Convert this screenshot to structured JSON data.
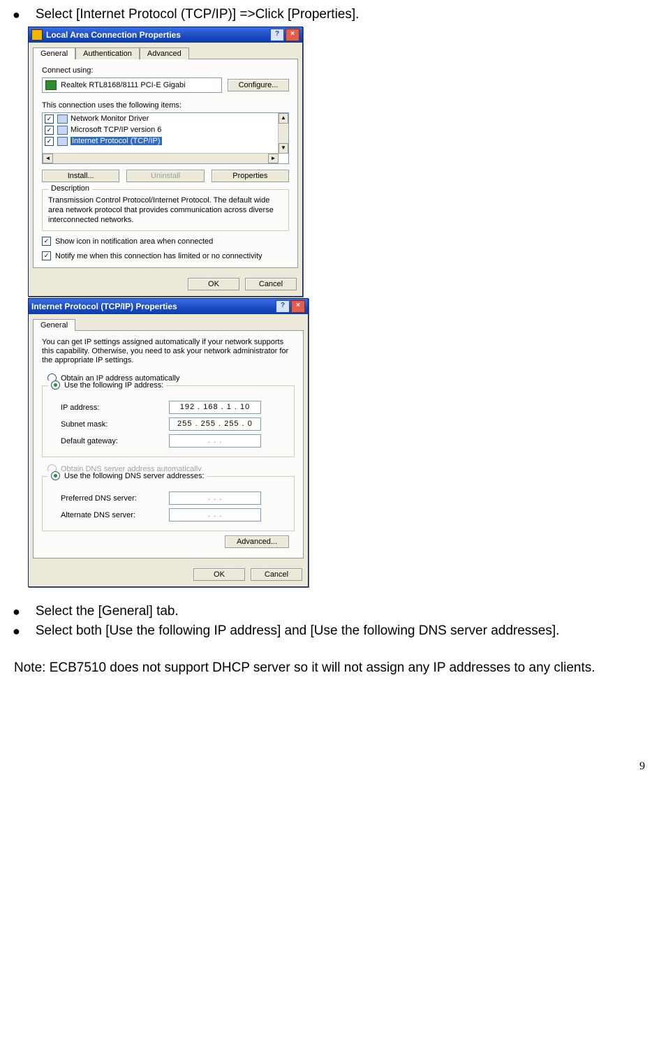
{
  "doc": {
    "bullet1": "Select [Internet Protocol (TCP/IP)] =>Click [Properties].",
    "bullet2": "Select the [General] tab.",
    "bullet3": "Select both [Use the following IP address] and [Use the following DNS server addresses].",
    "note": "Note: ECB7510 does not support DHCP server so it will not assign any IP addresses to any clients.",
    "page": "9"
  },
  "win1": {
    "title": "Local Area Connection Properties",
    "tabs": {
      "general": "General",
      "auth": "Authentication",
      "adv": "Advanced"
    },
    "connect_using_label": "Connect using:",
    "adapter": "Realtek RTL8168/8111 PCI-E Gigabi",
    "configure": "Configure...",
    "items_label": "This connection uses the following items:",
    "items": [
      "Network Monitor Driver",
      "Microsoft TCP/IP version 6",
      "Internet Protocol (TCP/IP)"
    ],
    "install": "Install...",
    "uninstall": "Uninstall",
    "properties": "Properties",
    "desc_legend": "Description",
    "desc_text": "Transmission Control Protocol/Internet Protocol. The default wide area network protocol that provides communication across diverse interconnected networks.",
    "show_icon": "Show icon in notification area when connected",
    "notify": "Notify me when this connection has limited or no connectivity",
    "ok": "OK",
    "cancel": "Cancel"
  },
  "win2": {
    "title": "Internet Protocol (TCP/IP) Properties",
    "tab_general": "General",
    "intro": "You can get IP settings assigned automatically if your network supports this capability. Otherwise, you need to ask your network administrator for the appropriate IP settings.",
    "obtain_ip": "Obtain an IP address automatically",
    "use_ip": "Use the following IP address:",
    "ip_label": "IP address:",
    "ip_value": "192 . 168 .  1  .  10",
    "subnet_label": "Subnet mask:",
    "subnet_value": "255 . 255 . 255 .  0",
    "gateway_label": "Default gateway:",
    "gateway_value": ".        .        .",
    "obtain_dns": "Obtain DNS server address automatically",
    "use_dns": "Use the following DNS server addresses:",
    "pref_dns_label": "Preferred DNS server:",
    "pref_dns_value": ".        .        .",
    "alt_dns_label": "Alternate DNS server:",
    "alt_dns_value": ".        .        .",
    "advanced": "Advanced...",
    "ok": "OK",
    "cancel": "Cancel"
  }
}
